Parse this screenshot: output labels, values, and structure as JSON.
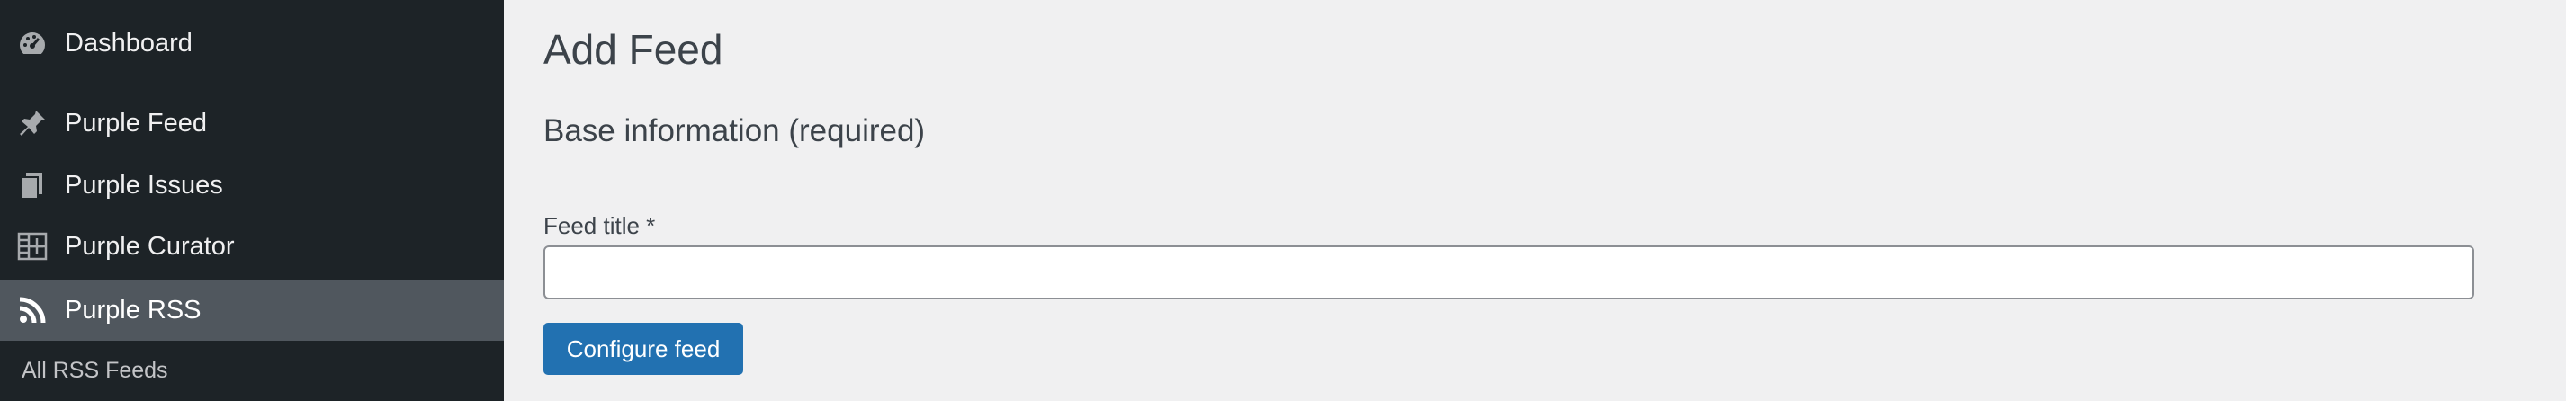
{
  "sidebar": {
    "items": [
      {
        "label": "Dashboard",
        "icon": "dashboard-icon"
      },
      {
        "label": "Purple Feed",
        "icon": "pin-icon"
      },
      {
        "label": "Purple Issues",
        "icon": "pages-icon"
      },
      {
        "label": "Purple Curator",
        "icon": "grid-add-icon"
      },
      {
        "label": "Purple RSS",
        "icon": "rss-icon",
        "active": true
      }
    ],
    "sub_items": [
      {
        "label": "All RSS Feeds"
      }
    ]
  },
  "main": {
    "page_title": "Add Feed",
    "section_title": "Base information (required)",
    "form": {
      "feed_title_label": "Feed title *",
      "feed_title_value": "",
      "submit_label": "Configure feed"
    }
  },
  "colors": {
    "sidebar_bg": "#1d2327",
    "active_bg": "#50575e",
    "page_bg": "#f0f0f1",
    "primary_button": "#2271b1"
  }
}
